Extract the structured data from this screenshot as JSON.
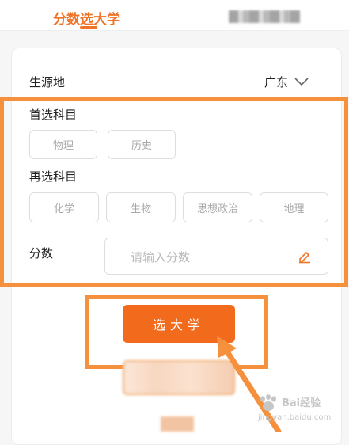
{
  "header": {
    "active_tab": "分数选大学"
  },
  "form": {
    "region_label": "生源地",
    "region_value": "广东",
    "first_subject_label": "首选科目",
    "first_subjects": [
      "物理",
      "历史"
    ],
    "second_subject_label": "再选科目",
    "second_subjects": [
      "化学",
      "生物",
      "思想政治",
      "地理"
    ],
    "score_label": "分数",
    "score_placeholder": "请输入分数"
  },
  "actions": {
    "select_university_label": "选大学"
  },
  "colors": {
    "accent": "#f26a1b",
    "brand_text": "#ef7427",
    "annotation": "#f5913d"
  },
  "watermark": {
    "text": "Bai经验",
    "url": "jingyan.baidu.com"
  }
}
